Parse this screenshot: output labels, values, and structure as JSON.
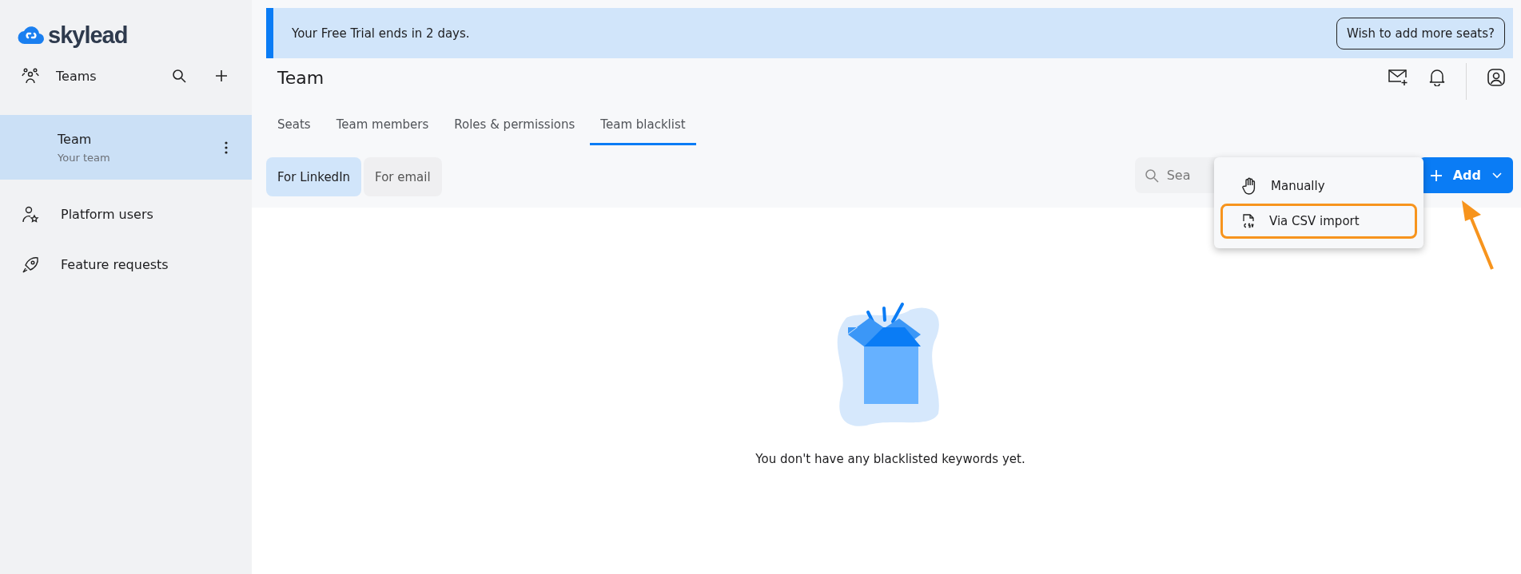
{
  "logo": {
    "text": "skylead"
  },
  "sidebar": {
    "header": {
      "label": "Teams"
    },
    "teams": [
      {
        "name": "Team",
        "subtitle": "Your team",
        "selected": true
      }
    ],
    "items": [
      {
        "label": "Platform users",
        "kind": "users"
      },
      {
        "label": "Feature requests",
        "kind": "rocket"
      }
    ]
  },
  "banner": {
    "message": "Your Free Trial ends in 2 days.",
    "button": "Wish to add more seats?"
  },
  "page": {
    "title": "Team"
  },
  "tabs": [
    {
      "label": "Seats",
      "selected": false
    },
    {
      "label": "Team members",
      "selected": false
    },
    {
      "label": "Roles & permissions",
      "selected": false
    },
    {
      "label": "Team blacklist",
      "selected": true
    }
  ],
  "subtabs": [
    {
      "label": "For LinkedIn",
      "selected": true
    },
    {
      "label": "For email",
      "selected": false
    }
  ],
  "search": {
    "placeholder": "Sea"
  },
  "add_button": {
    "label": "Add"
  },
  "add_menu": [
    {
      "label": "Manually",
      "kind": "hand",
      "highlighted": false
    },
    {
      "label": "Via CSV import",
      "kind": "csv",
      "highlighted": true
    }
  ],
  "empty_state": {
    "message": "You don't have any blacklisted keywords yet."
  }
}
